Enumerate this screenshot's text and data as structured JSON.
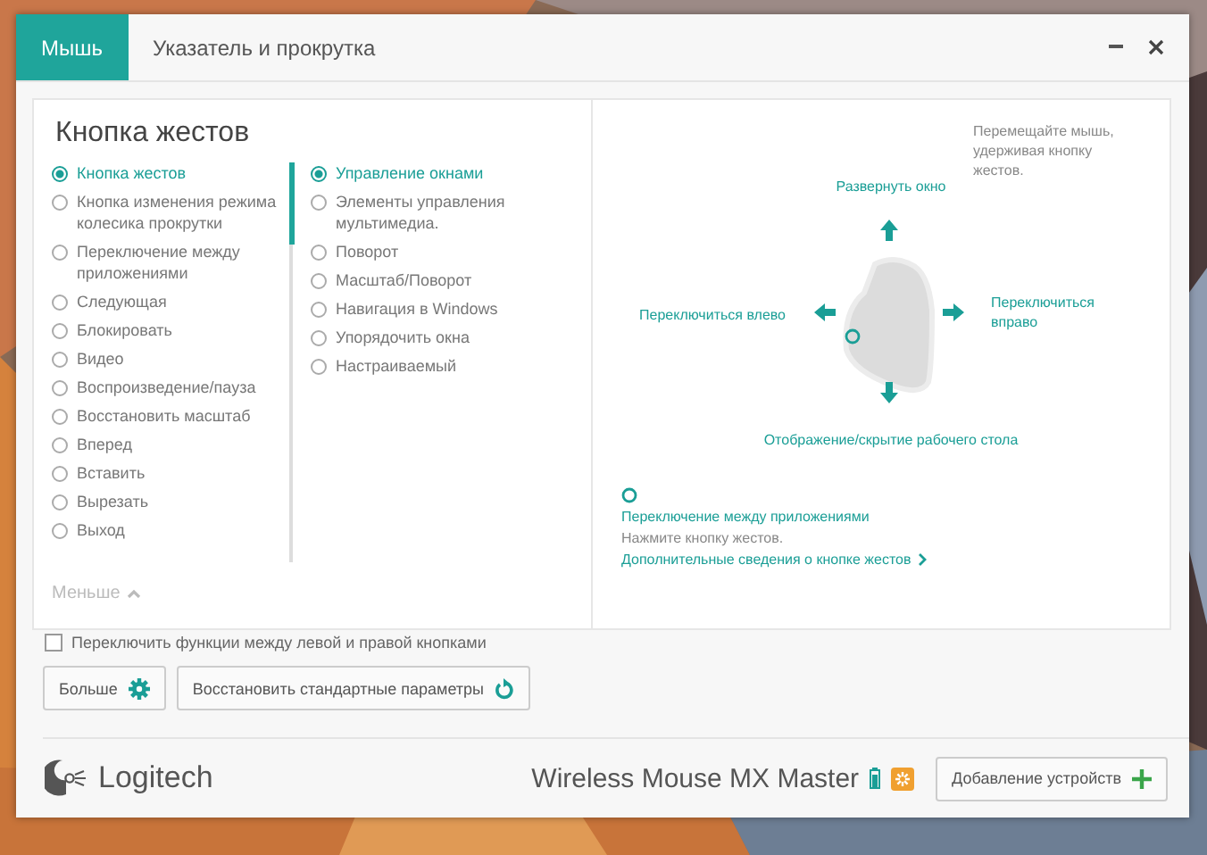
{
  "tabs": [
    {
      "label": "Мышь",
      "selected": true
    },
    {
      "label": "Указатель и прокрутка",
      "selected": false
    }
  ],
  "panel": {
    "title": "Кнопка жестов",
    "buttons_list": [
      {
        "label": "Кнопка жестов",
        "selected": true
      },
      {
        "label": "Кнопка изменения режима колесика прокрутки",
        "selected": false
      },
      {
        "label": "Переключение между приложениями",
        "selected": false
      },
      {
        "label": "Следующая",
        "selected": false
      },
      {
        "label": "Блокировать",
        "selected": false
      },
      {
        "label": "Видео",
        "selected": false
      },
      {
        "label": "Воспроизведение/пауза",
        "selected": false
      },
      {
        "label": "Восстановить масштаб",
        "selected": false
      },
      {
        "label": "Вперед",
        "selected": false
      },
      {
        "label": "Вставить",
        "selected": false
      },
      {
        "label": "Вырезать",
        "selected": false
      },
      {
        "label": "Выход",
        "selected": false
      }
    ],
    "actions_list": [
      {
        "label": "Управление окнами",
        "selected": true
      },
      {
        "label": "Элементы управления мультимедиа.",
        "selected": false
      },
      {
        "label": "Поворот",
        "selected": false
      },
      {
        "label": "Масштаб/Поворот",
        "selected": false
      },
      {
        "label": "Навигация в Windows",
        "selected": false
      },
      {
        "label": "Упорядочить окна",
        "selected": false
      },
      {
        "label": "Настраиваемый",
        "selected": false
      }
    ],
    "less": "Меньше",
    "hint": "Перемещайте мышь, удерживая кнопку жестов.",
    "directions": [
      {
        "kind": "up",
        "label": "Развернуть окно"
      },
      {
        "kind": "left",
        "label": "Переключиться влево"
      },
      {
        "kind": "right",
        "label": "Переключиться вправо"
      },
      {
        "kind": "down",
        "label": "Отображение/скрытие рабочего стола"
      }
    ],
    "current": {
      "title": "Переключение между приложениями",
      "description": "Нажмите кнопку жестов.",
      "link": "Дополнительные сведения о кнопке жестов"
    }
  },
  "swap_checkbox": {
    "label": "Переключить функции между левой и правой кнопками",
    "checked": false
  },
  "buttons": [
    {
      "label": "Больше",
      "kind": "gear"
    },
    {
      "label": "Восстановить стандартные параметры",
      "kind": "reset"
    }
  ],
  "footer": {
    "brand": "Logitech",
    "device": "Wireless Mouse MX Master",
    "add_device": "Добавление устройств"
  }
}
